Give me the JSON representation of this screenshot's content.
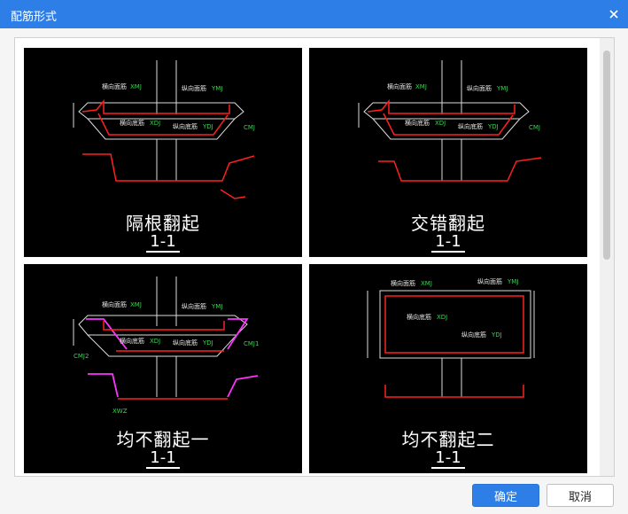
{
  "window": {
    "title": "配筋形式"
  },
  "panels": [
    {
      "name": "隔根翻起",
      "section": "1-1",
      "annotations": {
        "top_transverse": "横向面筋",
        "top_transverse_code": "XMJ",
        "top_longitudinal": "纵向面筋",
        "top_longitudinal_code": "YMJ",
        "bottom_transverse": "横向底筋",
        "bottom_transverse_code": "XDJ",
        "bottom_longitudinal": "纵向底筋",
        "bottom_longitudinal_code": "YDJ",
        "side_label": "CMJ"
      }
    },
    {
      "name": "交错翻起",
      "section": "1-1",
      "annotations": {
        "top_transverse": "横向面筋",
        "top_transverse_code": "XMJ",
        "top_longitudinal": "纵向面筋",
        "top_longitudinal_code": "YMJ",
        "bottom_transverse": "横向底筋",
        "bottom_transverse_code": "XDJ",
        "bottom_longitudinal": "纵向底筋",
        "bottom_longitudinal_code": "YDJ",
        "side_label": "CMJ"
      }
    },
    {
      "name": "均不翻起一",
      "section": "1-1",
      "annotations": {
        "top_transverse": "横向面筋",
        "top_transverse_code": "XMJ",
        "top_longitudinal": "纵向面筋",
        "top_longitudinal_code": "YMJ",
        "bottom_transverse": "横向底筋",
        "bottom_transverse_code": "XDJ",
        "bottom_longitudinal": "纵向底筋",
        "bottom_longitudinal_code": "YDJ",
        "side_label_right": "CMJ1",
        "side_label_left": "CMJ2",
        "bottom_label": "XWZ"
      }
    },
    {
      "name": "均不翻起二",
      "section": "1-1",
      "annotations": {
        "top_transverse": "横向面筋",
        "top_transverse_code": "XMJ",
        "top_longitudinal": "纵向面筋",
        "top_longitudinal_code": "YMJ",
        "bottom_transverse": "横向底筋",
        "bottom_transverse_code": "XDJ",
        "bottom_longitudinal": "纵向底筋",
        "bottom_longitudinal_code": "YDJ"
      }
    }
  ],
  "buttons": {
    "ok": "确定",
    "cancel": "取消"
  },
  "colors": {
    "titlebar": "#2d7ee6",
    "rebar": "#ff2020",
    "magenta": "#ff33ff",
    "annotation": "#39d44f"
  }
}
